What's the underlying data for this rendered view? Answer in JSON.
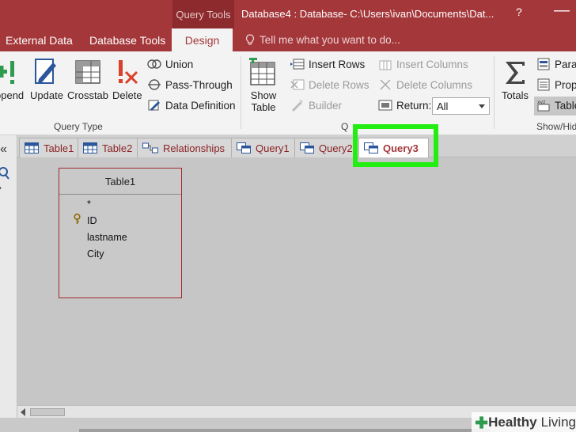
{
  "title_bar": {
    "context_label": "Query Tools",
    "title": "Database4 : Database- C:\\Users\\ivan\\Documents\\Dat...",
    "help": "?",
    "minimize": "—"
  },
  "ribbon_tabs": [
    {
      "label": "External Data"
    },
    {
      "label": "Database Tools"
    },
    {
      "label": "Design",
      "active": true
    }
  ],
  "tell_me": "Tell me what you want to do...",
  "ribbon": {
    "query_type_buttons": [
      {
        "label": "ppend",
        "icon": "append-icon"
      },
      {
        "label": "Update",
        "icon": "update-icon"
      },
      {
        "label": "Crosstab",
        "icon": "crosstab-icon"
      },
      {
        "label": "Delete",
        "icon": "delete-query-icon"
      }
    ],
    "query_type_small": [
      {
        "label": "Union",
        "icon": "union-icon"
      },
      {
        "label": "Pass-Through",
        "icon": "pass-through-icon"
      },
      {
        "label": "Data Definition",
        "icon": "data-definition-icon"
      }
    ],
    "query_type_label": "Query Type",
    "show_table": {
      "line1": "Show",
      "line2": "Table"
    },
    "setup_small": [
      {
        "label": "Insert Rows",
        "enabled": true
      },
      {
        "label": "Delete Rows",
        "enabled": false
      },
      {
        "label": "Builder",
        "enabled": false
      }
    ],
    "setup_small_right": [
      {
        "label": "Insert Columns",
        "enabled": false
      },
      {
        "label": "Delete Columns",
        "enabled": false
      }
    ],
    "return_label": "Return:",
    "return_value": "All",
    "setup_label": "Q",
    "totals": "Totals",
    "show_hide_items": [
      {
        "label": "Param"
      },
      {
        "label": "Prope"
      },
      {
        "label": "Table"
      }
    ],
    "show_hide_label": "Show/Hid"
  },
  "nav": {
    "collapse": "«"
  },
  "doc_tabs": [
    {
      "label": "Table1",
      "type": "table"
    },
    {
      "label": "Table2",
      "type": "table"
    },
    {
      "label": "Relationships",
      "type": "relationships"
    },
    {
      "label": "Query1",
      "type": "query"
    },
    {
      "label": "Query2",
      "type": "query"
    },
    {
      "label": "Query3",
      "type": "query",
      "active": true
    }
  ],
  "table_box": {
    "title": "Table1",
    "fields": [
      "*",
      "ID",
      "lastname",
      "City"
    ],
    "primary_key": "ID"
  },
  "watermark": {
    "brand1": "Healthy",
    "brand2": "Living"
  },
  "colors": {
    "accent": "#a4373a",
    "highlight": "#22ee11"
  }
}
